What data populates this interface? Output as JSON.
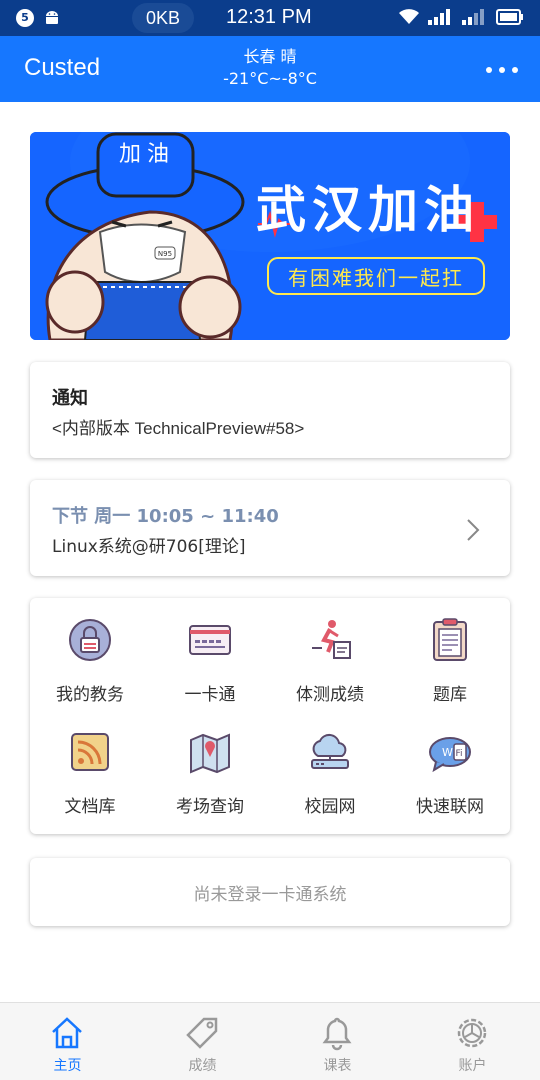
{
  "status_bar": {
    "badge": "5",
    "traffic": "0KB",
    "time": "12:31 PM",
    "icons": [
      "android-icon",
      "wifi-icon",
      "signal-icon",
      "signal-icon",
      "battery-icon"
    ]
  },
  "app_bar": {
    "title": "Custed",
    "weather_line1": "长春 晴",
    "weather_line2": "-21°C~-8°C",
    "menu_icon": "more-icon"
  },
  "banner": {
    "hat_text": "加油",
    "headline": "武汉加油",
    "slogan": "有困难我们一起扛",
    "mask_text": "N95",
    "colors": {
      "background": "#1565ff",
      "yellow": "#ffe94d"
    }
  },
  "notice": {
    "title": "通知",
    "body": "<内部版本 TechnicalPreview#58>"
  },
  "next_class": {
    "heading": "下节 周一 10:05 ~ 11:40",
    "course": "Linux系统@研706[理论]"
  },
  "features": [
    {
      "label": "我的教务",
      "icon": "lock-icon"
    },
    {
      "label": "一卡通",
      "icon": "card-icon"
    },
    {
      "label": "体测成绩",
      "icon": "runner-icon"
    },
    {
      "label": "题库",
      "icon": "clipboard-icon"
    },
    {
      "label": "文档库",
      "icon": "rss-icon"
    },
    {
      "label": "考场查询",
      "icon": "map-icon"
    },
    {
      "label": "校园网",
      "icon": "cloud-icon"
    },
    {
      "label": "快速联网",
      "icon": "wifi-bubble-icon"
    }
  ],
  "login_card": {
    "text": "尚未登录一卡通系统"
  },
  "tabs": [
    {
      "label": "主页",
      "icon": "home-icon",
      "active": true
    },
    {
      "label": "成绩",
      "icon": "tag-icon",
      "active": false
    },
    {
      "label": "课表",
      "icon": "bell-icon",
      "active": false
    },
    {
      "label": "账户",
      "icon": "gear-icon",
      "active": false
    }
  ],
  "colors": {
    "primary": "#1677ff",
    "status_bar": "#0b3d8c",
    "muted": "#999999"
  }
}
